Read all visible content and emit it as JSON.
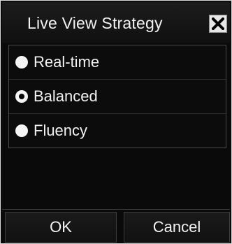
{
  "dialog": {
    "title": "Live View Strategy",
    "close_icon": "close-icon"
  },
  "options": [
    {
      "label": "Real-time",
      "selected": false
    },
    {
      "label": "Balanced",
      "selected": true
    },
    {
      "label": "Fluency",
      "selected": false
    }
  ],
  "buttons": {
    "ok_label": "OK",
    "cancel_label": "Cancel"
  },
  "colors": {
    "background": "#0a0a0a",
    "text": "#f2f2f2",
    "radio": "#f5f5f5",
    "close_button_bg": "#e6e6e6"
  }
}
